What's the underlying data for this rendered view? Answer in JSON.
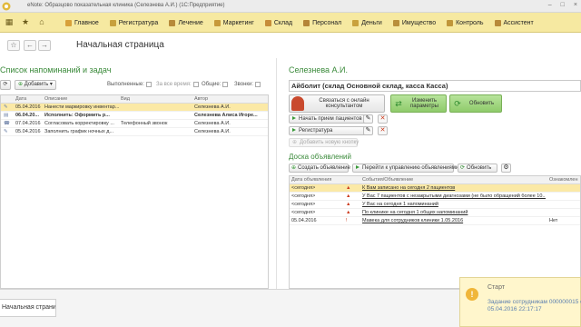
{
  "window": {
    "title": "eNote: Образцово показательная клиника (Селезнева А.И.)  (1С:Предприятие)",
    "controls": [
      "–",
      "□",
      "×"
    ]
  },
  "toolbar": {
    "icons": [
      "grid-icon",
      "star-icon",
      "home-icon"
    ],
    "nav": [
      {
        "label": "Главное",
        "color": "#d8a13a"
      },
      {
        "label": "Регистратура",
        "color": "#c7a03d"
      },
      {
        "label": "Лечение",
        "color": "#b78a3a"
      },
      {
        "label": "Маркетинг",
        "color": "#c79a3a"
      },
      {
        "label": "Склад",
        "color": "#c68d39"
      },
      {
        "label": "Персонал",
        "color": "#b58538"
      },
      {
        "label": "Деньги",
        "color": "#c9a23d"
      },
      {
        "label": "Имущество",
        "color": "#b98f3b"
      },
      {
        "label": "Контроль",
        "color": "#c0963a"
      },
      {
        "label": "Ассистент",
        "color": "#b88a3a"
      }
    ]
  },
  "page": {
    "title": "Начальная страница",
    "back": "←",
    "forward": "→"
  },
  "left": {
    "title": "Список напоминаний и задач",
    "add_button": "Добавить",
    "refresh_glyph": "⟳",
    "filters": [
      {
        "label": "Выполненные:"
      },
      {
        "label": "За все время:"
      },
      {
        "label": "Общие:"
      },
      {
        "label": "Звонки:"
      }
    ],
    "columns": [
      "Дата",
      "Описание",
      "Вид",
      "Автор"
    ],
    "rows": [
      {
        "date": "05.04.2016",
        "desc": "Нанести маркировку инвентар...",
        "kind": "",
        "author": "Селезнева А.И.",
        "selected": true,
        "bold": false
      },
      {
        "date": "06.04.20...",
        "desc": "Исполнить: Оформить р...",
        "kind": "",
        "author": "Селезнева Алиса Игоре...",
        "selected": false,
        "bold": true
      },
      {
        "date": "07.04.2016",
        "desc": "Согласовать корректировку ...",
        "kind": "Телефонный звонок",
        "author": "Селезнева А.И.",
        "selected": false,
        "bold": false
      },
      {
        "date": "05.04.2016",
        "desc": "Заполнить график ночных д...",
        "kind": "",
        "author": "Селезнева А.И.",
        "selected": false,
        "bold": false
      }
    ]
  },
  "right": {
    "user_name": "Селезнева А.И.",
    "org": "Айболит (склад Основной склад, касса Касса)",
    "contact_button": "Связаться с онлайн консультантом",
    "change_params_button": "Изменить параметры",
    "refresh_button": "Обновить",
    "start_reception_button": "Начать прием пациентов",
    "registry_button": "Регистратура",
    "add_new_button": "Добавить новую кнопку",
    "board": {
      "title": "Доска объявлений",
      "create_button": "Создать объявление",
      "manage_button": "Перейти к управлению объявлениями",
      "refresh_button": "Обновить",
      "columns": [
        "Дата объявления",
        "События/Объявление",
        "Ознакомлен"
      ],
      "rows": [
        {
          "date": "<сегодня>",
          "text": "К Вам записано на сегодня 2 пациентов",
          "ack": "",
          "icon": "warning",
          "selected": true
        },
        {
          "date": "<сегодня>",
          "text": "У Вас 7 пациентов с незакрытыми диагнозами (не было обращений более 10...",
          "ack": "",
          "icon": "warning",
          "selected": false
        },
        {
          "date": "<сегодня>",
          "text": "У Вас на сегодня 1 напоминаний",
          "ack": "",
          "icon": "warning",
          "selected": false
        },
        {
          "date": "<сегодня>",
          "text": "По клинике на сегодня 1 общих напоминаний",
          "ack": "",
          "icon": "warning",
          "selected": false
        },
        {
          "date": "05.04.2016",
          "text": "Мавека для сотрудников клиники 1.05.2016",
          "ack": "Нет",
          "icon": "exclamation",
          "selected": false
        }
      ]
    }
  },
  "statusbar": {
    "tab_label": "Начальная страница"
  },
  "toast": {
    "title": "Старт",
    "message": "Задание сотрудникам 000000015 от",
    "date": "05.04.2016 22:17:17",
    "icon": "info-icon"
  }
}
